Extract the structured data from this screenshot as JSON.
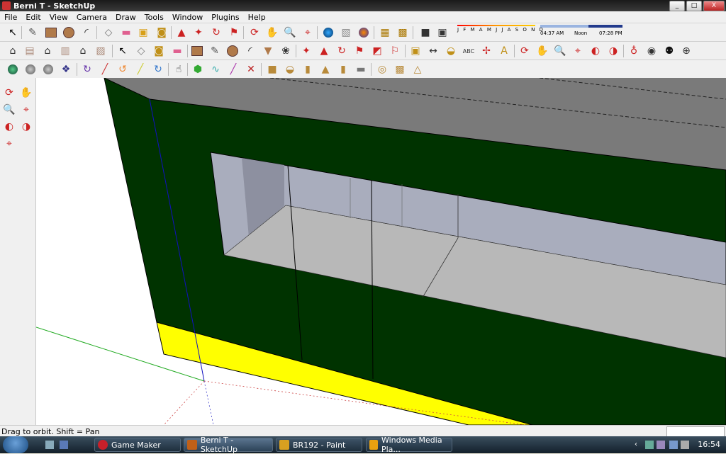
{
  "window": {
    "title": "Berni T - SketchUp",
    "buttons": [
      "_",
      "□",
      "X"
    ]
  },
  "menu": [
    "File",
    "Edit",
    "View",
    "Camera",
    "Draw",
    "Tools",
    "Window",
    "Plugins",
    "Help"
  ],
  "shadow": {
    "months": "J F M A M J J A S O N D",
    "time_start": "04:37 AM",
    "time_noon": "Noon",
    "time_end": "07:28 PM"
  },
  "status": {
    "text": "Drag to orbit.  Shift = Pan"
  },
  "taskbar": {
    "tasks": [
      {
        "label": "Game Maker",
        "color": "#c8202a"
      },
      {
        "label": "Berni T - SketchUp",
        "color": "#c06018"
      },
      {
        "label": "BR192 - Paint",
        "color": "#d8a020"
      },
      {
        "label": "Windows Media Pla...",
        "color": "#e8a010"
      }
    ],
    "clock": "16:54"
  },
  "colors": {
    "wall": "#003300",
    "yellow": "#ffff00",
    "roof": "#7a7a7a",
    "window_face": "#a9adbd",
    "window_floor": "#b8b8b8"
  }
}
